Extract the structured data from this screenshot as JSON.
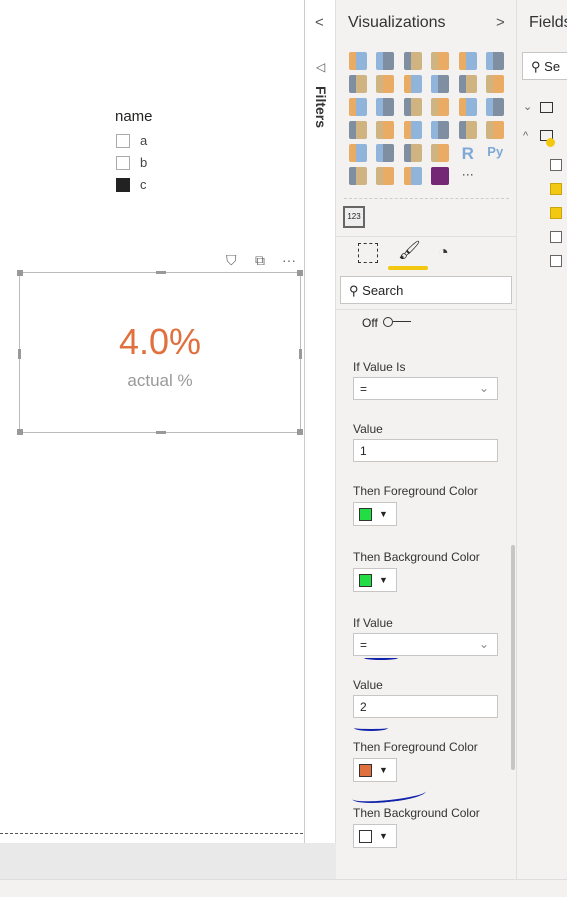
{
  "legend": {
    "title": "name",
    "items": [
      {
        "label": "a",
        "checked": false
      },
      {
        "label": "b",
        "checked": false
      },
      {
        "label": "c",
        "checked": true
      }
    ]
  },
  "card": {
    "value": "4.0%",
    "label": "actual %",
    "value_color": "#e0703d"
  },
  "filters": {
    "label": "Filters"
  },
  "visualizations": {
    "title": "Visualizations",
    "search_placeholder": "Search",
    "more": "···",
    "custom_visual": "123",
    "toggle_label": "Off",
    "rules": {
      "if_value_is_label": "If Value Is",
      "if_value_is": "=",
      "value1_label": "Value",
      "value1": "1",
      "fg1_label": "Then Foreground Color",
      "fg1_color": "#22dd44",
      "bg1_label": "Then Background Color",
      "bg1_color": "#22dd44",
      "if_value_label": "If Value",
      "if_value": "=",
      "value2_label": "Value",
      "value2": "2",
      "fg2_label": "Then Foreground Color",
      "fg2_color": "#e0703d",
      "bg2_label": "Then Background Color",
      "bg2_color": "#ffffff"
    }
  },
  "fields": {
    "title": "Fields",
    "search_placeholder": "Se"
  }
}
